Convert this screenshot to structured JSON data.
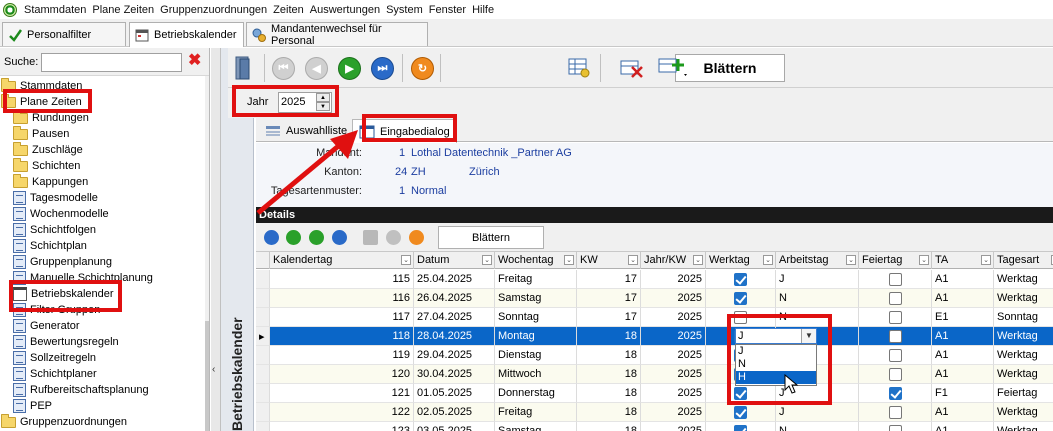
{
  "menu": [
    "Stammdaten",
    "Plane Zeiten",
    "Gruppenzuordnungen",
    "Zeiten",
    "Auswertungen",
    "System",
    "Fenster",
    "Hilfe"
  ],
  "tabs": [
    {
      "label": "Personalfilter",
      "icon": "tick-icon"
    },
    {
      "label": "Betriebskalender",
      "icon": "calendar-icon"
    },
    {
      "label": "Mandantenwechsel für Personal",
      "icon": "gears-icon"
    }
  ],
  "search": {
    "label": "Suche:",
    "value": ""
  },
  "tree": [
    {
      "label": "Stammdaten",
      "icon": "folder",
      "indent": 0
    },
    {
      "label": "Plane Zeiten",
      "icon": "folder",
      "indent": 0
    },
    {
      "label": "Rundungen",
      "icon": "folder",
      "indent": 1
    },
    {
      "label": "Pausen",
      "icon": "folder",
      "indent": 1
    },
    {
      "label": "Zuschläge",
      "icon": "folder",
      "indent": 1
    },
    {
      "label": "Schichten",
      "icon": "folder",
      "indent": 1
    },
    {
      "label": "Kappungen",
      "icon": "folder",
      "indent": 1
    },
    {
      "label": "Tagesmodelle",
      "icon": "doc",
      "indent": 1
    },
    {
      "label": "Wochenmodelle",
      "icon": "doc",
      "indent": 1
    },
    {
      "label": "Schichtfolgen",
      "icon": "doc",
      "indent": 1
    },
    {
      "label": "Schichtplan",
      "icon": "doc",
      "indent": 1
    },
    {
      "label": "Gruppenplanung",
      "icon": "doc",
      "indent": 1
    },
    {
      "label": "Manuelle Schichtplanung",
      "icon": "doc",
      "indent": 1
    },
    {
      "label": "Betriebskalender",
      "icon": "cal",
      "indent": 1
    },
    {
      "label": "Filter Gruppen",
      "icon": "doc",
      "indent": 1
    },
    {
      "label": "Generator",
      "icon": "doc",
      "indent": 1
    },
    {
      "label": "Bewertungsregeln",
      "icon": "doc",
      "indent": 1
    },
    {
      "label": "Sollzeitregeln",
      "icon": "doc",
      "indent": 1
    },
    {
      "label": "Schichtplaner",
      "icon": "doc",
      "indent": 1
    },
    {
      "label": "Rufbereitschaftsplanung",
      "icon": "doc",
      "indent": 1
    },
    {
      "label": "PEP",
      "icon": "doc",
      "indent": 1
    },
    {
      "label": "Gruppenzuordnungen",
      "icon": "folder",
      "indent": 0
    }
  ],
  "side_label": "Betriebskalender",
  "toolbar": {
    "blaettern": "Blättern"
  },
  "year": {
    "label": "Jahr",
    "value": "2025"
  },
  "subtabs": {
    "list": "Auswahlliste",
    "dialog": "Eingabedialog"
  },
  "info": {
    "mandant_label": "Mandant:",
    "mandant_nr": "1",
    "mandant_name": "Lothal Datentechnik _Partner AG",
    "kanton_label": "Kanton:",
    "kanton_nr": "24",
    "kanton_code": "ZH",
    "kanton_name": "Zürich",
    "muster_label": "Tagesartenmuster:",
    "muster_nr": "1",
    "muster_name": "Normal"
  },
  "details": {
    "title": "Details",
    "blaettern": "Blättern"
  },
  "columns": [
    "Kalendertag",
    "Datum",
    "Wochentag",
    "KW",
    "Jahr/KW",
    "Werktag",
    "Arbeitstag",
    "Feiertag",
    "TA",
    "Tagesart"
  ],
  "rows": [
    {
      "kalendertag": "115",
      "datum": "25.04.2025",
      "wochentag": "Freitag",
      "kw": "17",
      "jahr": "2025",
      "werktag": true,
      "arbeitstag": "J",
      "feiertag": false,
      "ta": "A1",
      "tagesart": "Werktag"
    },
    {
      "kalendertag": "116",
      "datum": "26.04.2025",
      "wochentag": "Samstag",
      "kw": "17",
      "jahr": "2025",
      "werktag": true,
      "arbeitstag": "N",
      "feiertag": false,
      "ta": "A1",
      "tagesart": "Werktag"
    },
    {
      "kalendertag": "117",
      "datum": "27.04.2025",
      "wochentag": "Sonntag",
      "kw": "17",
      "jahr": "2025",
      "werktag": false,
      "arbeitstag": "N",
      "feiertag": false,
      "ta": "E1",
      "tagesart": "Sonntag"
    },
    {
      "kalendertag": "118",
      "datum": "28.04.2025",
      "wochentag": "Montag",
      "kw": "18",
      "jahr": "2025",
      "werktag": true,
      "arbeitstag": "J",
      "feiertag": false,
      "ta": "A1",
      "tagesart": "Werktag"
    },
    {
      "kalendertag": "119",
      "datum": "29.04.2025",
      "wochentag": "Dienstag",
      "kw": "18",
      "jahr": "2025",
      "werktag": true,
      "arbeitstag": "J",
      "feiertag": false,
      "ta": "A1",
      "tagesart": "Werktag"
    },
    {
      "kalendertag": "120",
      "datum": "30.04.2025",
      "wochentag": "Mittwoch",
      "kw": "18",
      "jahr": "2025",
      "werktag": true,
      "arbeitstag": "N",
      "feiertag": false,
      "ta": "A1",
      "tagesart": "Werktag"
    },
    {
      "kalendertag": "121",
      "datum": "01.05.2025",
      "wochentag": "Donnerstag",
      "kw": "18",
      "jahr": "2025",
      "werktag": true,
      "arbeitstag": "J",
      "feiertag": true,
      "ta": "F1",
      "tagesart": "Feiertag"
    },
    {
      "kalendertag": "122",
      "datum": "02.05.2025",
      "wochentag": "Freitag",
      "kw": "18",
      "jahr": "2025",
      "werktag": true,
      "arbeitstag": "J",
      "feiertag": false,
      "ta": "A1",
      "tagesart": "Werktag"
    },
    {
      "kalendertag": "123",
      "datum": "03.05.2025",
      "wochentag": "Samstag",
      "kw": "18",
      "jahr": "2025",
      "werktag": true,
      "arbeitstag": "N",
      "feiertag": false,
      "ta": "A1",
      "tagesart": "Werktag"
    }
  ],
  "selected_row": 3,
  "combo": {
    "value": "J",
    "options": [
      "J",
      "N",
      "H"
    ],
    "highlighted": "H"
  },
  "colors": {
    "selection": "#0a66c8",
    "annotation": "#e01010"
  }
}
